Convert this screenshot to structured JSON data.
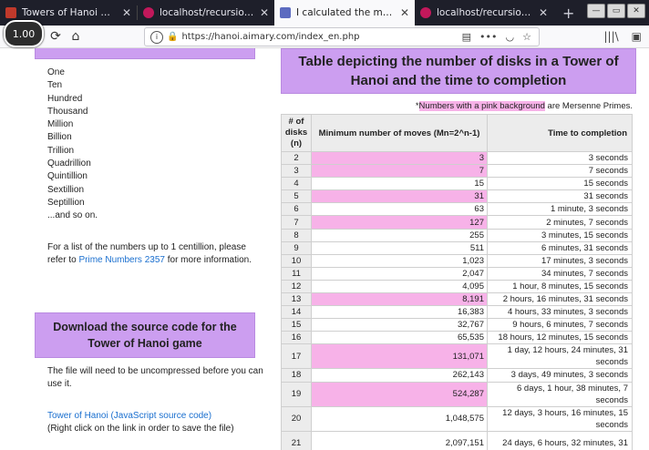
{
  "browser": {
    "tabs": [
      {
        "title": "Towers of Hanoi Animation",
        "favicon_color": "#c0392b",
        "active": false
      },
      {
        "title": "localhost/recursion/towers_",
        "favicon_color": "#c2185b",
        "active": false
      },
      {
        "title": "I calculated the minimum an",
        "favicon_color": "#5c6bc0",
        "active": true
      },
      {
        "title": "localhost/recursion/towers_",
        "favicon_color": "#c2185b",
        "active": false
      }
    ],
    "new_tab_label": "+",
    "zoom_badge": "1.00",
    "url": "https://hanoi.aimary.com/index_en.php",
    "icons": [
      "back-icon",
      "reload-icon",
      "home-icon",
      "info-icon",
      "lock-icon",
      "reader-icon",
      "more-icon",
      "pocket-icon",
      "bookmark-star-icon",
      "library-icon",
      "sidebar-icon"
    ]
  },
  "left": {
    "numbers": [
      "One",
      "Ten",
      "Hundred",
      "Thousand",
      "Million",
      "Billion",
      "Trillion",
      "Quadrillion",
      "Quintillion",
      "Sextillion",
      "Septillion",
      "...and so on."
    ],
    "list_para_before": "For a list of the numbers up to 1 centillion, please refer to ",
    "list_link": "Prime Numbers 2357",
    "list_para_after": " for more information.",
    "download_title": "Download the source code for the Tower of Hanoi game",
    "uncompress_note": "The file will need to be uncompressed before you can use it.",
    "source_link": "Tower of Hanoi (JavaScript source code)",
    "right_click_note": "(Right click on the link in order to save the file)"
  },
  "right": {
    "title": "Table depicting the number of disks in a Tower of Hanoi and the time to completion",
    "note_prefix": "*",
    "note_pink": "Numbers with a pink background",
    "note_suffix": " are Mersenne Primes.",
    "headers": [
      "# of disks (n)",
      "Minimum number of moves (Mn=2^n-1)",
      "Time to completion"
    ],
    "rows": [
      {
        "n": "2",
        "moves": "3",
        "time": "3 seconds",
        "pink": true
      },
      {
        "n": "3",
        "moves": "7",
        "time": "7 seconds",
        "pink": true
      },
      {
        "n": "4",
        "moves": "15",
        "time": "15 seconds",
        "pink": false
      },
      {
        "n": "5",
        "moves": "31",
        "time": "31 seconds",
        "pink": true
      },
      {
        "n": "6",
        "moves": "63",
        "time": "1 minute, 3 seconds",
        "pink": false
      },
      {
        "n": "7",
        "moves": "127",
        "time": "2 minutes, 7 seconds",
        "pink": true
      },
      {
        "n": "8",
        "moves": "255",
        "time": "3 minutes, 15 seconds",
        "pink": false
      },
      {
        "n": "9",
        "moves": "511",
        "time": "6 minutes, 31 seconds",
        "pink": false
      },
      {
        "n": "10",
        "moves": "1,023",
        "time": "17 minutes, 3 seconds",
        "pink": false
      },
      {
        "n": "11",
        "moves": "2,047",
        "time": "34 minutes, 7 seconds",
        "pink": false
      },
      {
        "n": "12",
        "moves": "4,095",
        "time": "1 hour, 8 minutes, 15 seconds",
        "pink": false
      },
      {
        "n": "13",
        "moves": "8,191",
        "time": "2 hours, 16 minutes, 31 seconds",
        "pink": true
      },
      {
        "n": "14",
        "moves": "16,383",
        "time": "4 hours, 33 minutes, 3 seconds",
        "pink": false
      },
      {
        "n": "15",
        "moves": "32,767",
        "time": "9 hours, 6 minutes, 7 seconds",
        "pink": false
      },
      {
        "n": "16",
        "moves": "65,535",
        "time": "18 hours, 12 minutes, 15 seconds",
        "pink": false
      },
      {
        "n": "17",
        "moves": "131,071",
        "time": "1 day, 12 hours, 24 minutes, 31 seconds",
        "pink": true,
        "tall": true
      },
      {
        "n": "18",
        "moves": "262,143",
        "time": "3 days, 49 minutes, 3 seconds",
        "pink": false
      },
      {
        "n": "19",
        "moves": "524,287",
        "time": "6 days, 1 hour, 38 minutes, 7 seconds",
        "pink": true,
        "tall": true
      },
      {
        "n": "20",
        "moves": "1,048,575",
        "time": "12 days, 3 hours, 16 minutes, 15 seconds",
        "pink": false,
        "tall": true
      },
      {
        "n": "21",
        "moves": "2,097,151",
        "time": "24 days, 6 hours, 32 minutes, 31",
        "pink": false,
        "tall": true
      }
    ]
  },
  "colors": {
    "tab_bar": "#1e1f2a",
    "purple_box": "#cc9ef0",
    "mersenne_pink": "#f7b2e8",
    "link_blue": "#1a6fcf"
  }
}
